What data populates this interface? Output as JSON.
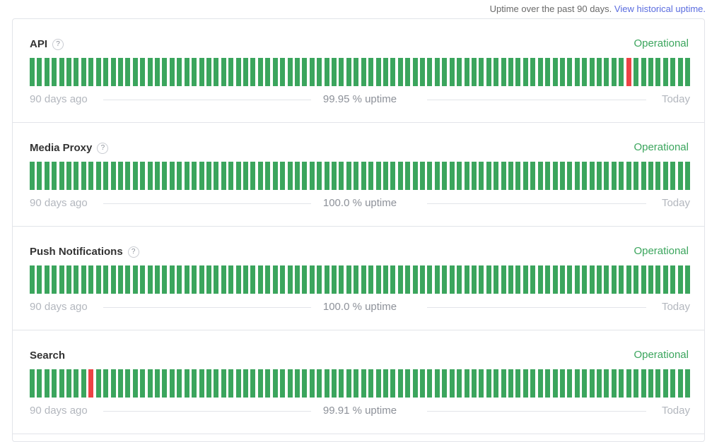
{
  "header": {
    "uptime_note": "Uptime over the past 90 days.",
    "history_link": "View historical uptime."
  },
  "colors": {
    "up": "#3ba55d",
    "down": "#ed4245"
  },
  "components": [
    {
      "name": "API",
      "has_help": true,
      "status": "Operational",
      "uptime": "99.95 % uptime",
      "start_label": "90 days ago",
      "end_label": "Today",
      "outage_day_indices": [
        81
      ]
    },
    {
      "name": "Media Proxy",
      "has_help": true,
      "status": "Operational",
      "uptime": "100.0 % uptime",
      "start_label": "90 days ago",
      "end_label": "Today",
      "outage_day_indices": []
    },
    {
      "name": "Push Notifications",
      "has_help": true,
      "status": "Operational",
      "uptime": "100.0 % uptime",
      "start_label": "90 days ago",
      "end_label": "Today",
      "outage_day_indices": []
    },
    {
      "name": "Search",
      "has_help": false,
      "status": "Operational",
      "uptime": "99.91 % uptime",
      "start_label": "90 days ago",
      "end_label": "Today",
      "outage_day_indices": [
        8
      ]
    }
  ],
  "help_glyph": "?",
  "days": 90
}
